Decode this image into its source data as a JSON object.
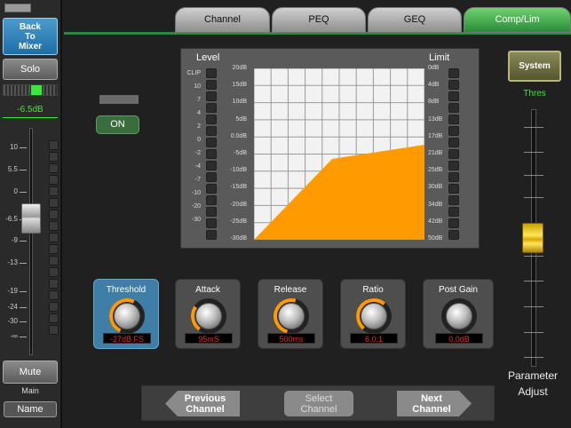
{
  "left_strip": {
    "back_button_label": "Back\nTo\nMixer",
    "solo_label": "Solo",
    "gain": "-6.5dB",
    "fader_scale": [
      "10",
      "5.5",
      "0",
      "-6.5",
      "-9",
      "-13",
      "-19",
      "-24",
      "-30",
      "-∞"
    ],
    "fader_level_db": -6.5,
    "mute_label": "Mute",
    "bus_label": "Main",
    "name_button_label": "Name"
  },
  "tabs": [
    {
      "label": "Channel",
      "active": false
    },
    {
      "label": "PEQ",
      "active": false
    },
    {
      "label": "GEQ",
      "active": false
    },
    {
      "label": "Comp/Lim",
      "active": true
    }
  ],
  "on_button_label": "ON",
  "graph": {
    "level_title": "Level",
    "limit_title": "Limit",
    "level_scale": [
      "CLIP",
      "10",
      "7",
      "4",
      "2",
      "0",
      "-2",
      "-4",
      "-7",
      "-10",
      "-20",
      "-30"
    ],
    "db_scale": [
      "20dB",
      "15dB",
      "10dB",
      "5dB",
      "0.0dB",
      "-5dB",
      "-10dB",
      "-15dB",
      "-20dB",
      "-25dB",
      "-30dB"
    ],
    "limit_scale": [
      "0dB",
      "4dB",
      "8dB",
      "13dB",
      "17dB",
      "21dB",
      "25dB",
      "30dB",
      "34dB",
      "42dB",
      "50dB"
    ],
    "curve_color": "#ff9a00"
  },
  "knobs": [
    {
      "title": "Threshold",
      "value": "-27dB FS",
      "active": true
    },
    {
      "title": "Attack",
      "value": "95mS",
      "active": false
    },
    {
      "title": "Release",
      "value": "500ms",
      "active": false
    },
    {
      "title": "Ratio",
      "value": "6.0:1",
      "active": false
    },
    {
      "title": "Post Gain",
      "value": "0.0dB",
      "active": false
    }
  ],
  "nav": {
    "prev_label": "Previous\nChannel",
    "select_label": "Select\nChannel",
    "next_label": "Next\nChannel"
  },
  "right_panel": {
    "system_label": "System",
    "thres_label": "Thres",
    "param_label": "Parameter\nAdjust"
  },
  "colors": {
    "accent_green": "#3ce83c",
    "tab_active": "#2a8a3a",
    "value_red": "#e03030",
    "knob_arc": "#ff9a00"
  }
}
